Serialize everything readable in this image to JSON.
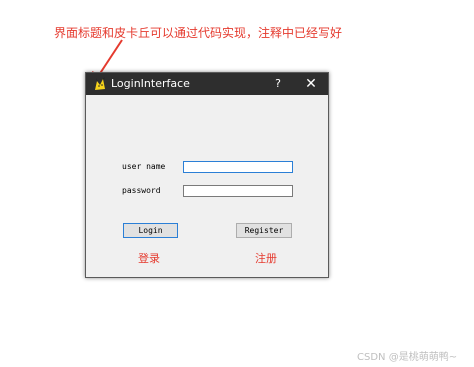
{
  "annotations": {
    "top": "界面标题和皮卡丘可以通过代码实现，注释中已经写好",
    "login_caption": "登录",
    "register_caption": "注册"
  },
  "window": {
    "title": "LoginInterface",
    "help": "?",
    "close": "✕",
    "icon": "pikachu-icon"
  },
  "form": {
    "user_label": "user name",
    "password_label": "password",
    "user_value": "",
    "password_value": ""
  },
  "buttons": {
    "login": "Login",
    "register": "Register"
  },
  "watermark": "CSDN @是桃萌萌鸭~",
  "colors": {
    "annotation": "#e53a2e",
    "titlebar": "#2e2e2e",
    "focus": "#2b7fd6"
  }
}
